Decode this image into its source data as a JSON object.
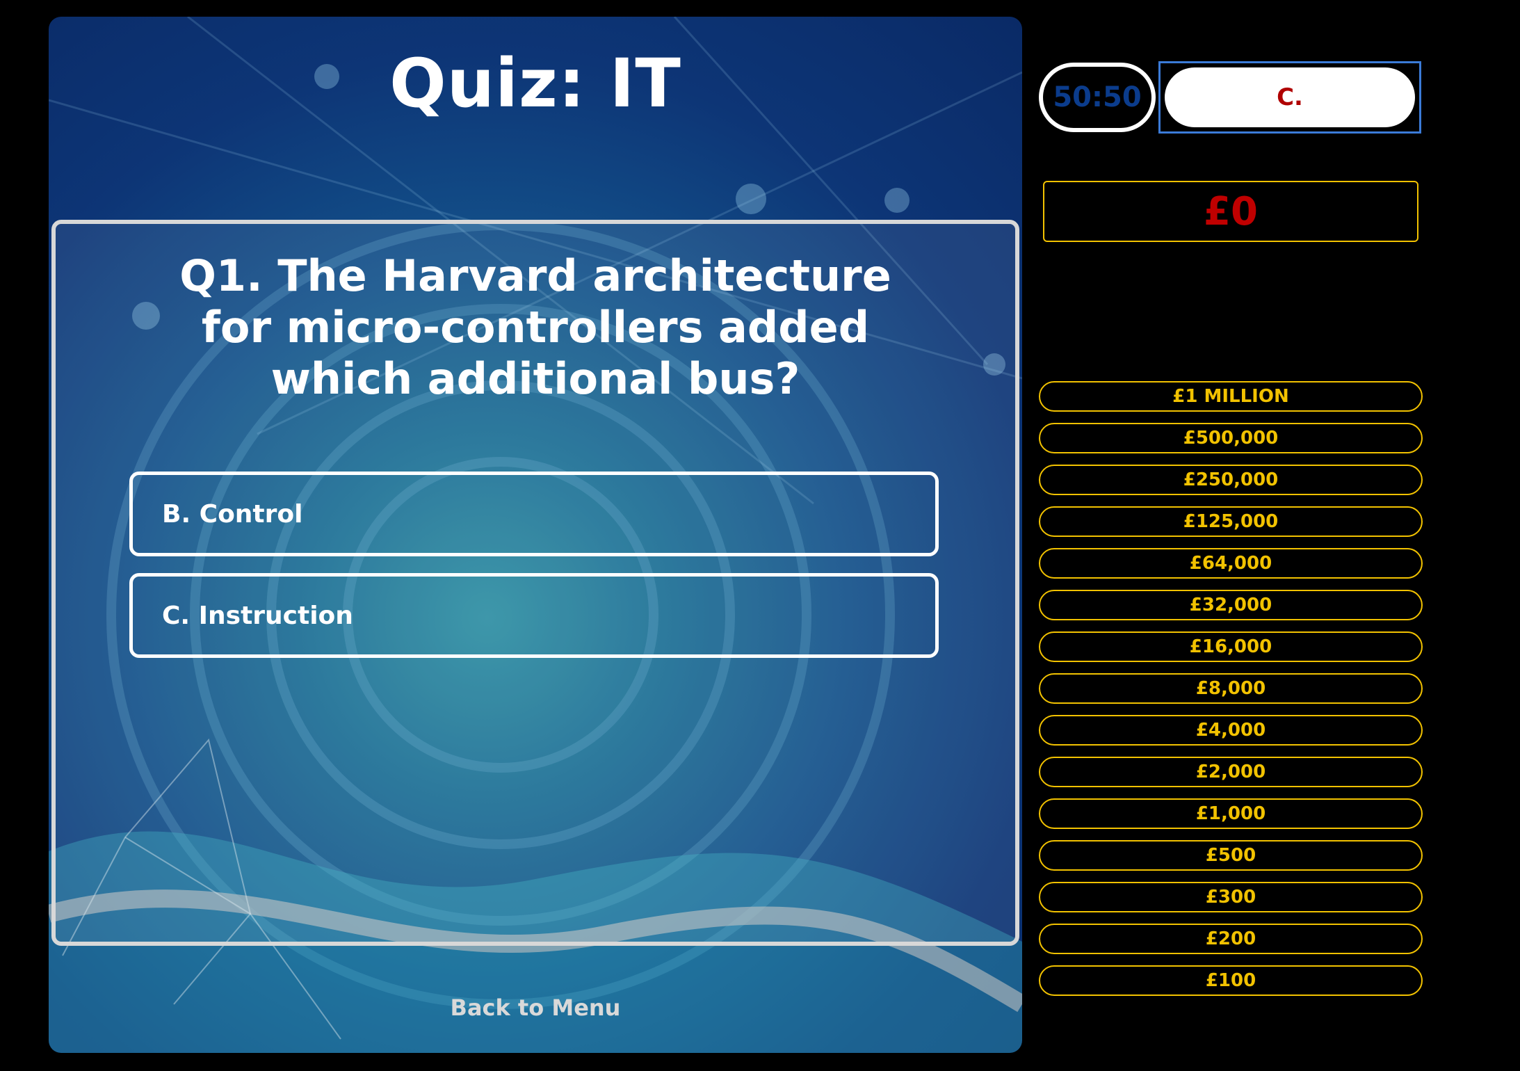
{
  "quiz": {
    "title": "Quiz: IT",
    "question": "Q1. The Harvard architecture for micro-controllers added which additional bus?",
    "answers": [
      {
        "label": "B. Control"
      },
      {
        "label": "C. Instruction"
      }
    ],
    "back_label": "Back to Menu"
  },
  "lifelines": {
    "fifty_fifty_label": "50:50",
    "hint_answer": "C."
  },
  "winnings": {
    "current": "£0"
  },
  "ladder": {
    "items": [
      "£1 MILLION",
      "£500,000",
      "£250,000",
      "£125,000",
      "£64,000",
      "£32,000",
      "£16,000",
      "£8,000",
      "£4,000",
      "£2,000",
      "£1,000",
      "£500",
      "£300",
      "£200",
      "£100"
    ]
  },
  "colors": {
    "ladder_gold": "#f2c200",
    "winnings_red": "#c00000",
    "hint_red": "#b00000",
    "fifty_blue": "#0b3c8c"
  }
}
